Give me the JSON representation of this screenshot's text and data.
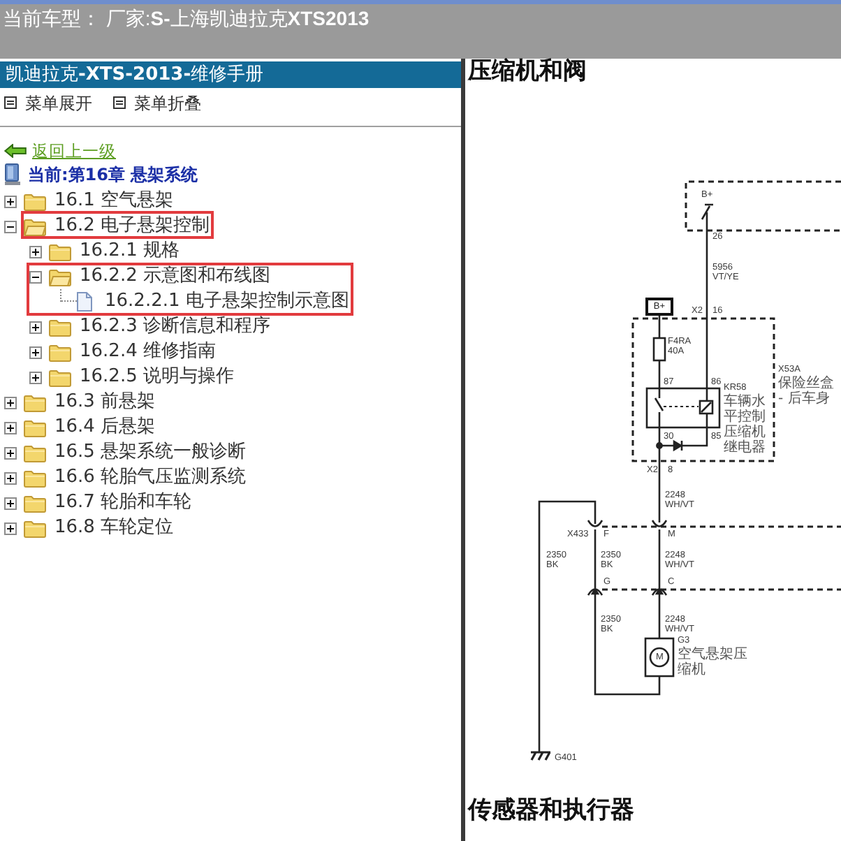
{
  "header": {
    "text": "当前车型： 厂家:**S-**上海凯迪拉克**XTS2013**"
  },
  "sidebar": {
    "title": "凯迪拉克**-XTS-2013-**维修手册",
    "menu_actions": [
      "菜单展开",
      "菜单折叠"
    ],
    "back_link": "返回上一级",
    "current": "当前:第16章 悬架系统",
    "tree": [
      {
        "label": "16.1 空气悬架",
        "kind": "folder",
        "expanded": false,
        "highlighted": false
      },
      {
        "label": "16.2 电子悬架控制",
        "kind": "folder",
        "expanded": true,
        "highlighted": true,
        "children": [
          {
            "label": "16.2.1 规格",
            "kind": "folder",
            "expanded": false,
            "highlighted": false
          },
          {
            "label": "16.2.2 示意图和布线图",
            "kind": "folder",
            "expanded": true,
            "highlighted": true,
            "children": [
              {
                "label": "16.2.2.1 电子悬架控制示意图",
                "kind": "page",
                "highlighted": true
              }
            ]
          },
          {
            "label": "16.2.3 诊断信息和程序",
            "kind": "folder",
            "expanded": false,
            "highlighted": false
          },
          {
            "label": "16.2.4 维修指南",
            "kind": "folder",
            "expanded": false,
            "highlighted": false
          },
          {
            "label": "16.2.5 说明与操作",
            "kind": "folder",
            "expanded": false,
            "highlighted": false
          }
        ]
      },
      {
        "label": "16.3 前悬架",
        "kind": "folder",
        "expanded": false,
        "highlighted": false
      },
      {
        "label": "16.4 后悬架",
        "kind": "folder",
        "expanded": false,
        "highlighted": false
      },
      {
        "label": "16.5 悬架系统一般诊断",
        "kind": "folder",
        "expanded": false,
        "highlighted": false
      },
      {
        "label": "16.6 轮胎气压监测系统",
        "kind": "folder",
        "expanded": false,
        "highlighted": false
      },
      {
        "label": "16.7 轮胎和车轮",
        "kind": "folder",
        "expanded": false,
        "highlighted": false
      },
      {
        "label": "16.8 车轮定位",
        "kind": "folder",
        "expanded": false,
        "highlighted": false
      }
    ]
  },
  "content": {
    "heading": "压缩机和阀",
    "diagram": {
      "upper_module": {
        "supply": "B+",
        "pin": "26"
      },
      "feed_wire": {
        "circuit": "5956",
        "insulation": "VT/YE"
      },
      "fuse_block": {
        "name": "X53A",
        "description": "保险丝盒 - 后车身",
        "supply": "B+",
        "feed_connector": "X2",
        "feed_pin": "16",
        "fuse": "F4RA",
        "fuse_rating": "40A",
        "relay": {
          "name": "KR58",
          "description": "车辆水平控制压缩机继电器",
          "pins": [
            "87",
            "86",
            "30",
            "85"
          ]
        },
        "out_connector": "X2",
        "out_pin": "8"
      },
      "out_wire": {
        "circuit": "2248",
        "insulation": "WH/VT"
      },
      "connector_1": {
        "name": "X433",
        "pins": [
          "F",
          "M"
        ]
      },
      "ground_wire": {
        "circuit": "2350",
        "insulation": "BK"
      },
      "wires_1": [
        {
          "circuit": "2350",
          "insulation": "BK"
        },
        {
          "circuit": "2248",
          "insulation": "WH/VT"
        }
      ],
      "connector_2": {
        "pins": [
          "G",
          "C"
        ]
      },
      "wires_2": [
        {
          "circuit": "2350",
          "insulation": "BK"
        },
        {
          "circuit": "2248",
          "insulation": "WH/VT"
        }
      ],
      "motor": {
        "symbol": "M",
        "name": "G3",
        "description": "空气悬架压缩机"
      },
      "ground": {
        "name": "G401"
      }
    },
    "next_heading": "传感器和执行器"
  }
}
